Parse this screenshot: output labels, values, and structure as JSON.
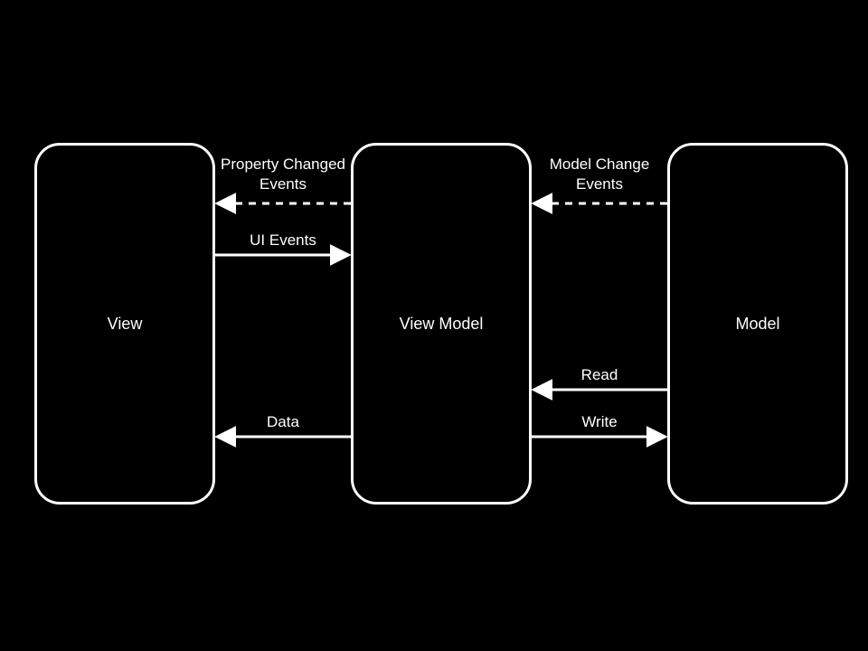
{
  "nodes": {
    "view": {
      "label": "View"
    },
    "view_model": {
      "label": "View Model"
    },
    "model": {
      "label": "Model"
    }
  },
  "edges": {
    "property_changed": {
      "label": "Property Changed\nEvents"
    },
    "ui_events": {
      "label": "UI Events"
    },
    "data": {
      "label": "Data"
    },
    "model_change": {
      "label": "Model Change\nEvents"
    },
    "read": {
      "label": "Read"
    },
    "write": {
      "label": "Write"
    }
  }
}
